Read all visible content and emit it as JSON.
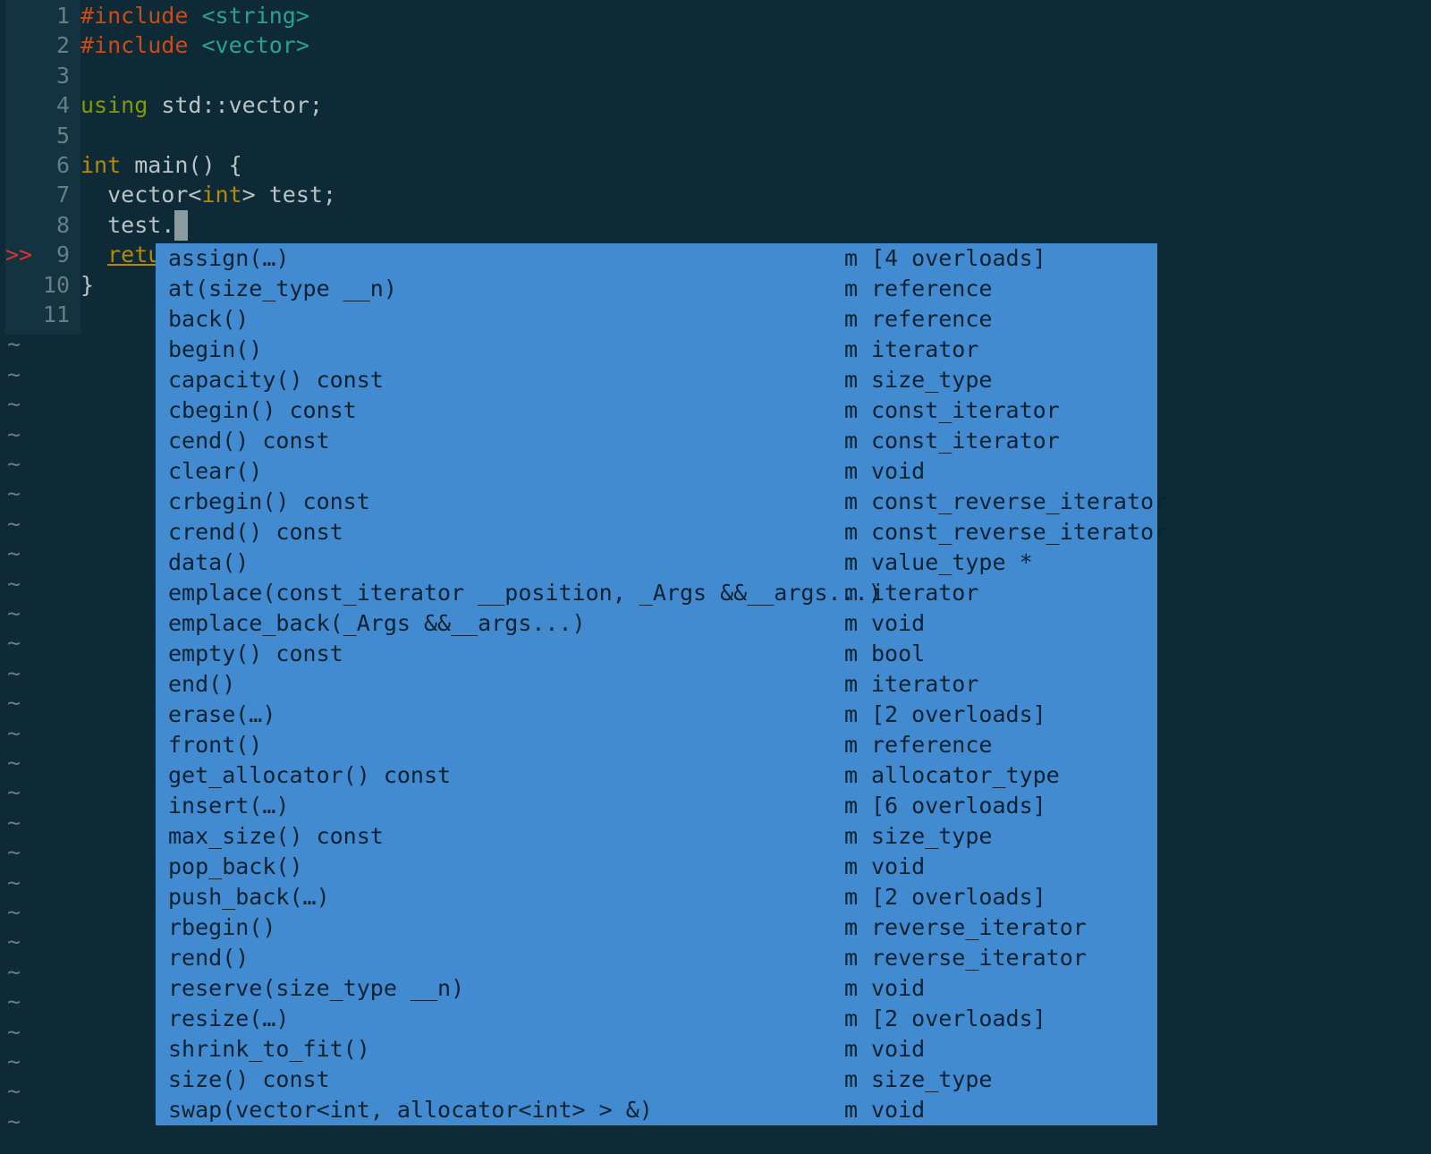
{
  "editor": {
    "lines": [
      {
        "num": "1",
        "parts": [
          {
            "text": "#include",
            "cls": "kw-pre"
          },
          {
            "text": " ",
            "cls": "txt"
          },
          {
            "text": "<string>",
            "cls": "kw-inc"
          }
        ]
      },
      {
        "num": "2",
        "parts": [
          {
            "text": "#include",
            "cls": "kw-pre"
          },
          {
            "text": " ",
            "cls": "txt"
          },
          {
            "text": "<vector>",
            "cls": "kw-inc"
          }
        ]
      },
      {
        "num": "3",
        "parts": []
      },
      {
        "num": "4",
        "parts": [
          {
            "text": "using",
            "cls": "kw-green"
          },
          {
            "text": " std::vector;",
            "cls": "txt"
          }
        ]
      },
      {
        "num": "5",
        "parts": []
      },
      {
        "num": "6",
        "parts": [
          {
            "text": "int",
            "cls": "kw-type"
          },
          {
            "text": " main() {",
            "cls": "txt"
          }
        ]
      },
      {
        "num": "7",
        "parts": [
          {
            "text": "  vector<",
            "cls": "txt"
          },
          {
            "text": "int",
            "cls": "kw-type"
          },
          {
            "text": "> test;",
            "cls": "txt"
          }
        ]
      },
      {
        "num": "8",
        "parts": [
          {
            "text": "  test.",
            "cls": "txt"
          },
          {
            "text": "",
            "cls": "cursor"
          }
        ]
      },
      {
        "num": "9",
        "parts": [
          {
            "text": "  ",
            "cls": "txt"
          },
          {
            "text": "retu",
            "cls": "underline"
          }
        ]
      },
      {
        "num": "10",
        "parts": [
          {
            "text": "}",
            "cls": "txt"
          }
        ]
      },
      {
        "num": "11",
        "parts": []
      }
    ],
    "sign_marker": ">>",
    "sign_line": "9",
    "tilde_char": "~",
    "tilde_count": 27
  },
  "completion": {
    "items": [
      {
        "name": "assign(…)",
        "kind": "m",
        "type": "[4 overloads]"
      },
      {
        "name": "at(size_type __n)",
        "kind": "m",
        "type": "reference"
      },
      {
        "name": "back()",
        "kind": "m",
        "type": "reference"
      },
      {
        "name": "begin()",
        "kind": "m",
        "type": "iterator"
      },
      {
        "name": "capacity() const",
        "kind": "m",
        "type": "size_type"
      },
      {
        "name": "cbegin() const",
        "kind": "m",
        "type": "const_iterator"
      },
      {
        "name": "cend() const",
        "kind": "m",
        "type": "const_iterator"
      },
      {
        "name": "clear()",
        "kind": "m",
        "type": "void"
      },
      {
        "name": "crbegin() const",
        "kind": "m",
        "type": "const_reverse_iterator"
      },
      {
        "name": "crend() const",
        "kind": "m",
        "type": "const_reverse_iterator"
      },
      {
        "name": "data()",
        "kind": "m",
        "type": "value_type *"
      },
      {
        "name": "emplace(const_iterator __position, _Args &&__args...)",
        "kind": "m",
        "type": "iterator"
      },
      {
        "name": "emplace_back(_Args &&__args...)",
        "kind": "m",
        "type": "void"
      },
      {
        "name": "empty() const",
        "kind": "m",
        "type": "bool"
      },
      {
        "name": "end()",
        "kind": "m",
        "type": "iterator"
      },
      {
        "name": "erase(…)",
        "kind": "m",
        "type": "[2 overloads]"
      },
      {
        "name": "front()",
        "kind": "m",
        "type": "reference"
      },
      {
        "name": "get_allocator() const",
        "kind": "m",
        "type": "allocator_type"
      },
      {
        "name": "insert(…)",
        "kind": "m",
        "type": "[6 overloads]"
      },
      {
        "name": "max_size() const",
        "kind": "m",
        "type": "size_type"
      },
      {
        "name": "pop_back()",
        "kind": "m",
        "type": "void"
      },
      {
        "name": "push_back(…)",
        "kind": "m",
        "type": "[2 overloads]"
      },
      {
        "name": "rbegin()",
        "kind": "m",
        "type": "reverse_iterator"
      },
      {
        "name": "rend()",
        "kind": "m",
        "type": "reverse_iterator"
      },
      {
        "name": "reserve(size_type __n)",
        "kind": "m",
        "type": "void"
      },
      {
        "name": "resize(…)",
        "kind": "m",
        "type": "[2 overloads]"
      },
      {
        "name": "shrink_to_fit()",
        "kind": "m",
        "type": "void"
      },
      {
        "name": "size() const",
        "kind": "m",
        "type": "size_type"
      },
      {
        "name": "swap(vector<int, allocator<int> > &)",
        "kind": "m",
        "type": "void"
      }
    ]
  },
  "colors": {
    "background": "#0e2a36",
    "gutter": "#133340",
    "popup": "#428bd0",
    "sign": "#dc322f"
  }
}
